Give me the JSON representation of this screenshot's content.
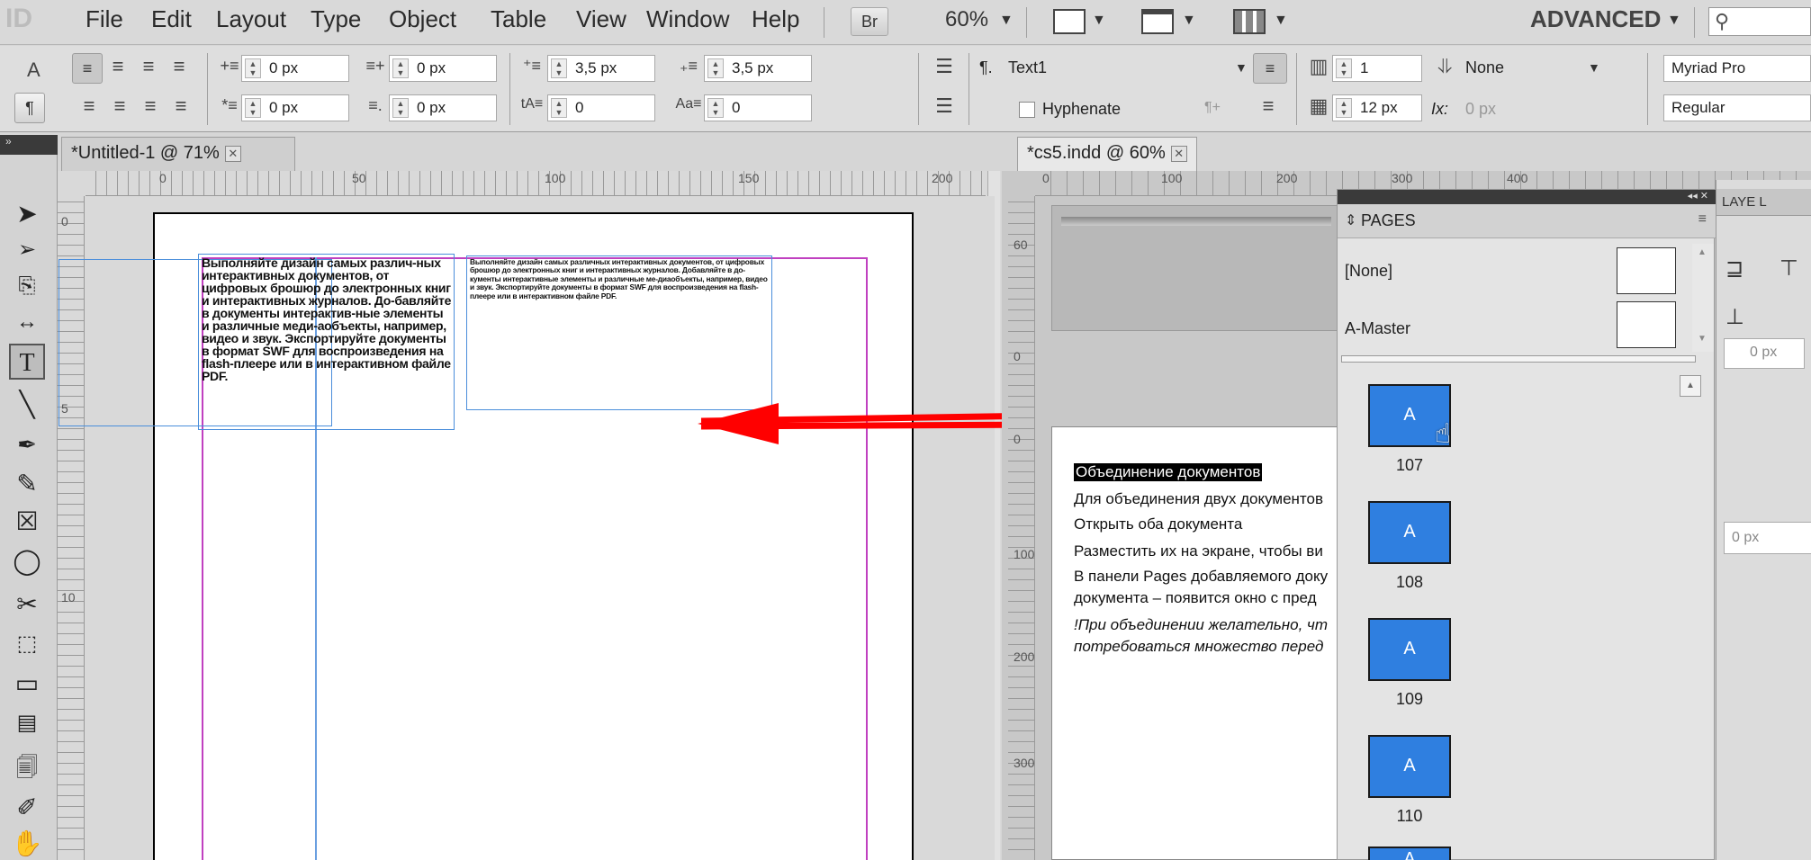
{
  "menubar": {
    "logo": "ID",
    "items": [
      "File",
      "Edit",
      "Layout",
      "Type",
      "Object",
      "Table",
      "View",
      "Window",
      "Help"
    ],
    "bridge_label": "Br",
    "zoom": "60%",
    "workspace": "ADVANCED"
  },
  "control": {
    "left_indent": "0 px",
    "first_indent": "0 px",
    "right_indent": "0 px",
    "last_indent": "0 px",
    "space_before": "3,5 px",
    "space_after": "3,5 px",
    "dropcap_lines": "0",
    "dropcap_chars": "0",
    "style": "Text1",
    "hyphenate_label": "Hyphenate",
    "columns": "1",
    "gutter": "12 px",
    "span": "None",
    "x_offset": "0 px",
    "font_family": "Myriad Pro",
    "font_style": "Regular"
  },
  "left_doc": {
    "tab_title": "*Untitled-1 @ 71%",
    "ruler_h": [
      "0",
      "50",
      "100",
      "150",
      "200"
    ],
    "ruler_v": [
      "0",
      "5",
      "10"
    ],
    "text_a": "Выполняйте дизайн самых различ-ных интерактивных документов, от цифровых брошюр до электронных книг и интерактивных журналов. До-бавляйте в документы интерактив-ные элементы и различные меди-аобъекты, например, видео и звук. Экспортируйте документы в формат SWF для воспроизведения на flash-плеере или в интерактивном файле PDF.",
    "text_b": "Выполняйте дизайн самых различных интерактивных документов, от цифровых брошюр до электронных книг и интерактивных журналов. Добавляйте в до-кументы интерактивные элементы и различные ме-диаобъекты, например, видео и звук. Экспортируйте документы в формат SWF для воспроизведения на flash-плеере или в интерактивном файле PDF."
  },
  "right_doc": {
    "tab_title": "*cs5.indd @ 60%",
    "ruler_h": [
      "0",
      "100",
      "200",
      "300",
      "400"
    ],
    "ruler_v": [
      "60",
      "0",
      "0",
      "100",
      "200",
      "300"
    ],
    "heading": "Объединение документов",
    "lines": [
      "Для объединения двух документов",
      "Открыть оба документа",
      "Разместить их на экране, чтобы ви",
      "В панели Pages добавляемого доку",
      "документа – появится окно с пред"
    ],
    "italic_lines": [
      "!При объединении желательно, чт",
      "потребоваться множество перед"
    ]
  },
  "pages_panel": {
    "title": "PAGES",
    "master_none": "[None]",
    "master_a": "A-Master",
    "thumb_letter": "A",
    "pages": [
      "107",
      "108",
      "109",
      "110"
    ]
  },
  "right_panel": {
    "tabs_label": "LAYE L",
    "field1": "0 px",
    "field2": "0 px"
  }
}
